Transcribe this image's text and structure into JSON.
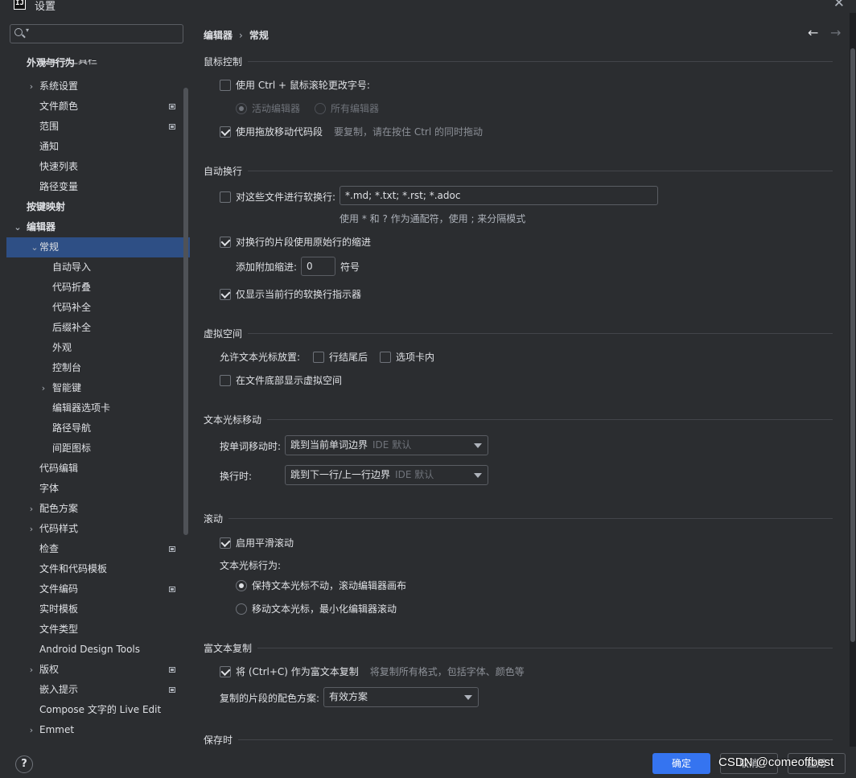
{
  "window": {
    "title": "设置",
    "close": "✕",
    "app_icon_text": "IJ"
  },
  "search": {
    "placeholder": "",
    "value": ""
  },
  "sidebar": {
    "partial_item": "菜单与工具栏",
    "items": [
      {
        "label": "外观与行为",
        "level": 0,
        "bold": true,
        "chevron": ""
      },
      {
        "label": "系统设置",
        "level": 1,
        "chevron": "›"
      },
      {
        "label": "文件颜色",
        "level": 1,
        "badge": true
      },
      {
        "label": "范围",
        "level": 1,
        "badge": true
      },
      {
        "label": "通知",
        "level": 1
      },
      {
        "label": "快速列表",
        "level": 1
      },
      {
        "label": "路径变量",
        "level": 1
      },
      {
        "label": "按键映射",
        "level": 0,
        "bold": true
      },
      {
        "label": "编辑器",
        "level": 0,
        "bold": true,
        "chevron": "⌄"
      },
      {
        "label": "常规",
        "level": 1,
        "chevron": "⌄",
        "selected": true
      },
      {
        "label": "自动导入",
        "level": 2
      },
      {
        "label": "代码折叠",
        "level": 2
      },
      {
        "label": "代码补全",
        "level": 2
      },
      {
        "label": "后缀补全",
        "level": 2
      },
      {
        "label": "外观",
        "level": 2
      },
      {
        "label": "控制台",
        "level": 2
      },
      {
        "label": "智能键",
        "level": 2,
        "chevron": "›"
      },
      {
        "label": "编辑器选项卡",
        "level": 2
      },
      {
        "label": "路径导航",
        "level": 2
      },
      {
        "label": "间距图标",
        "level": 2
      },
      {
        "label": "代码编辑",
        "level": 1
      },
      {
        "label": "字体",
        "level": 1
      },
      {
        "label": "配色方案",
        "level": 1,
        "chevron": "›"
      },
      {
        "label": "代码样式",
        "level": 1,
        "chevron": "›"
      },
      {
        "label": "检查",
        "level": 1,
        "badge": true
      },
      {
        "label": "文件和代码模板",
        "level": 1
      },
      {
        "label": "文件编码",
        "level": 1,
        "badge": true
      },
      {
        "label": "实时模板",
        "level": 1
      },
      {
        "label": "文件类型",
        "level": 1
      },
      {
        "label": "Android Design Tools",
        "level": 1
      },
      {
        "label": "版权",
        "level": 1,
        "chevron": "›",
        "badge": true
      },
      {
        "label": "嵌入提示",
        "level": 1,
        "badge": true
      },
      {
        "label": "Compose 文字的 Live Edit",
        "level": 1
      },
      {
        "label": "Emmet",
        "level": 1,
        "chevron": "›"
      }
    ]
  },
  "breadcrumb": {
    "parent": "编辑器",
    "sep": "›",
    "current": "常规"
  },
  "nav": {
    "back": "←",
    "forward": "→"
  },
  "sections": {
    "mouse": {
      "title": "鼠标控制",
      "ctrl_wheel": "使用 Ctrl + 鼠标滚轮更改字号:",
      "active_editor": "活动编辑器",
      "all_editors": "所有编辑器",
      "drag_move": "使用拖放移动代码段",
      "drag_hint": "要复制，请在按住 Ctrl 的同时拖动"
    },
    "softwrap": {
      "title": "自动换行",
      "files_label": "对这些文件进行软换行:",
      "files_value": "*.md; *.txt; *.rst; *.adoc",
      "files_hint": "使用 * 和 ? 作为通配符，使用 ; 来分隔模式",
      "indent_label": "对换行的片段使用原始行的缩进",
      "extra_indent_label": "添加附加缩进:",
      "extra_indent_value": "0",
      "extra_indent_unit": "符号",
      "current_line_only": "仅显示当前行的软换行指示器"
    },
    "virtual": {
      "title": "虚拟空间",
      "allow_label": "允许文本光标放置:",
      "line_end": "行结尾后",
      "in_tab": "选项卡内",
      "show_bottom": "在文件底部显示虚拟空间"
    },
    "caret": {
      "title": "文本光标移动",
      "word_label": "按单词移动时:",
      "word_value": "跳到当前单词边界",
      "word_sub": "IDE 默认",
      "line_label": "换行时:",
      "line_value": "跳到下一行/上一行边界",
      "line_sub": "IDE 默认"
    },
    "scroll": {
      "title": "滚动",
      "smooth": "启用平滑滚动",
      "caret_behavior": "文本光标行为:",
      "keep_caret": "保持文本光标不动，滚动编辑器画布",
      "move_caret": "移动文本光标，最小化编辑器滚动"
    },
    "rich": {
      "title": "富文本复制",
      "copy_label": "将 (Ctrl+C) 作为富文本复制",
      "copy_hint": "将复制所有格式，包括字体、颜色等",
      "scheme_label": "复制的片段的配色方案:",
      "scheme_value": "有效方案"
    },
    "save": {
      "title": "保存时"
    }
  },
  "footer": {
    "help": "?",
    "ok": "确定",
    "cancel": "取消",
    "apply": "应用",
    "watermark": "CSDN @comeoffbest"
  },
  "colors": {
    "accent": "#3574f0",
    "selection": "#2e4f85",
    "bg": "#2b2d30"
  }
}
